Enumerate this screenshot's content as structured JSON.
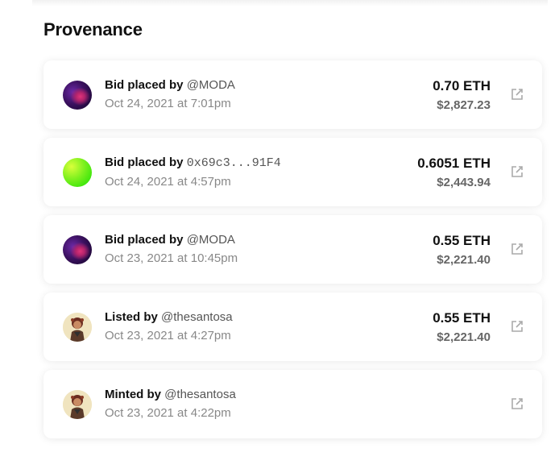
{
  "section": {
    "title": "Provenance"
  },
  "colors": {
    "text": "#111111",
    "muted": "#888888",
    "card_bg": "#ffffff"
  },
  "events": [
    {
      "action": "Bid placed by",
      "actor": "@MODA",
      "actor_type": "handle",
      "avatar": "moda-avatar",
      "date": "Oct 24, 2021 at 7:01pm",
      "eth": "0.70 ETH",
      "usd": "$2,827.23",
      "link_icon": "external-link-icon"
    },
    {
      "action": "Bid placed by",
      "actor": "0x69c3...91F4",
      "actor_type": "address",
      "avatar": "green-gradient-avatar",
      "date": "Oct 24, 2021 at 4:57pm",
      "eth": "0.6051 ETH",
      "usd": "$2,443.94",
      "link_icon": "external-link-icon"
    },
    {
      "action": "Bid placed by",
      "actor": "@MODA",
      "actor_type": "handle",
      "avatar": "moda-avatar",
      "date": "Oct 23, 2021 at 10:45pm",
      "eth": "0.55 ETH",
      "usd": "$2,221.40",
      "link_icon": "external-link-icon"
    },
    {
      "action": "Listed by",
      "actor": "@thesantosa",
      "actor_type": "handle",
      "avatar": "thesantosa-avatar",
      "date": "Oct 23, 2021 at 4:27pm",
      "eth": "0.55 ETH",
      "usd": "$2,221.40",
      "link_icon": "external-link-icon"
    },
    {
      "action": "Minted by",
      "actor": "@thesantosa",
      "actor_type": "handle",
      "avatar": "thesantosa-avatar",
      "date": "Oct 23, 2021 at 4:22pm",
      "link_icon": "external-link-icon"
    }
  ]
}
